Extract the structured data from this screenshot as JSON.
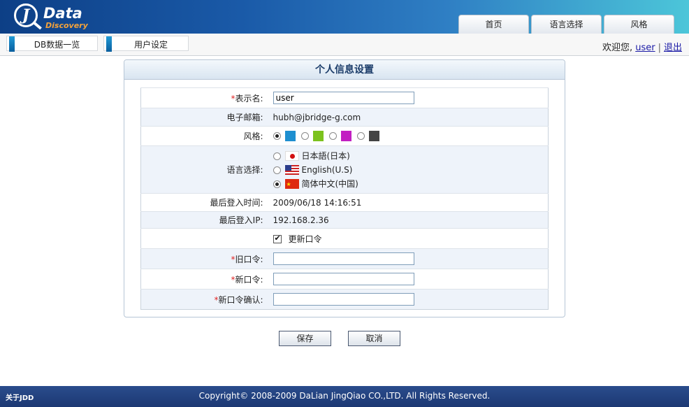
{
  "logo": {
    "letter": "J",
    "word": "Data",
    "sub": "Discovery"
  },
  "top_tabs": [
    "首页",
    "语言选择",
    "风格"
  ],
  "subnav": {
    "tab1": "DB数据一览",
    "tab2": "用户设定"
  },
  "user_box": {
    "welcome": "欢迎您,",
    "user": "user",
    "sep": "|",
    "logout": "退出"
  },
  "panel": {
    "title": "个人信息设置"
  },
  "form": {
    "display_name": {
      "required": "*",
      "label": "表示名:",
      "value": "user"
    },
    "email": {
      "label": "电子邮箱:",
      "value": "hubh@jbridge-g.com"
    },
    "style": {
      "label": "风格:",
      "options": [
        "#1e8fd0",
        "#7cc21d",
        "#c21fc2",
        "#444444"
      ],
      "selected": 0
    },
    "language": {
      "label": "语言选择:",
      "options": [
        "日本語(日本)",
        "English(U.S)",
        "简体中文(中国)"
      ],
      "selected": 2
    },
    "last_login_time": {
      "label": "最后登入时间:",
      "value": "2009/06/18 14:16:51"
    },
    "last_login_ip": {
      "label": "最后登入IP:",
      "value": "192.168.2.36"
    },
    "update_password": {
      "label": "更新口令",
      "checked": true
    },
    "old_password": {
      "required": "*",
      "label": "旧口令:"
    },
    "new_password": {
      "required": "*",
      "label": "新口令:"
    },
    "confirm_password": {
      "required": "*",
      "label": "新口令确认:"
    }
  },
  "buttons": {
    "save": "保存",
    "cancel": "取消"
  },
  "footer": {
    "about": "关于JDD",
    "copyright": "Copyright© 2008-2009 DaLian JingQiao CO.,LTD. All Rights Reserved."
  }
}
